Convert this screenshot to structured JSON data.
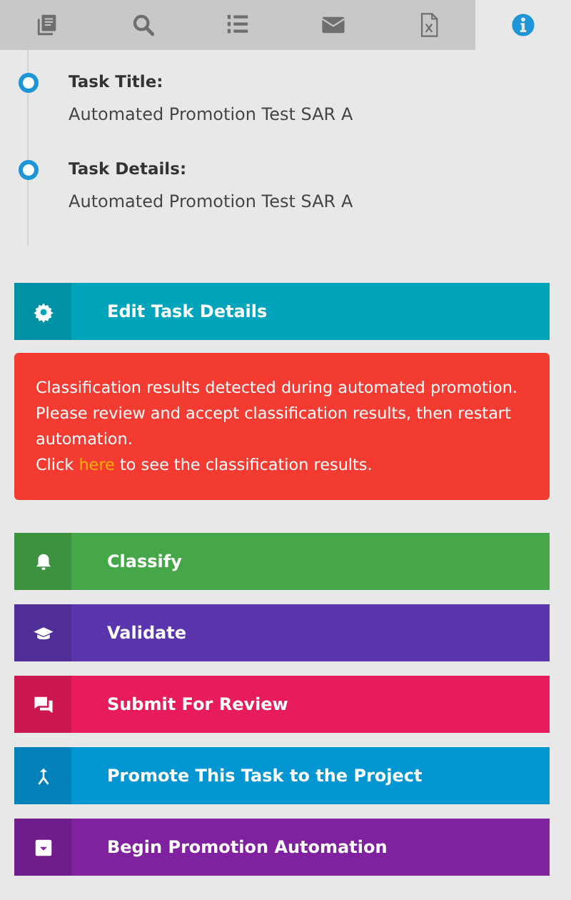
{
  "tabs": [
    {
      "selected": false
    },
    {
      "selected": false
    },
    {
      "selected": false
    },
    {
      "selected": false
    },
    {
      "selected": false
    },
    {
      "selected": true
    }
  ],
  "timeline": [
    {
      "label": "Task Title:",
      "value": "Automated Promotion Test SAR A"
    },
    {
      "label": "Task Details:",
      "value": "Automated Promotion Test SAR A"
    }
  ],
  "edit_button": {
    "label": "Edit Task Details",
    "color": "#00a5bb"
  },
  "alert": {
    "message": "Classification results detected during automated promotion. Please review and accept classification results, then restart automation.",
    "link_prefix": "Click ",
    "link": "here",
    "link_suffix": " to see the classification results."
  },
  "actions": [
    {
      "label": "Classify",
      "color": "#46a748"
    },
    {
      "label": "Validate",
      "color": "#5b35ae"
    },
    {
      "label": "Submit For Review",
      "color": "#e81c5a"
    },
    {
      "label": "Promote This Task to the Project",
      "color": "#0495d3"
    },
    {
      "label": "Begin Promotion Automation",
      "color": "#8022a0"
    }
  ]
}
